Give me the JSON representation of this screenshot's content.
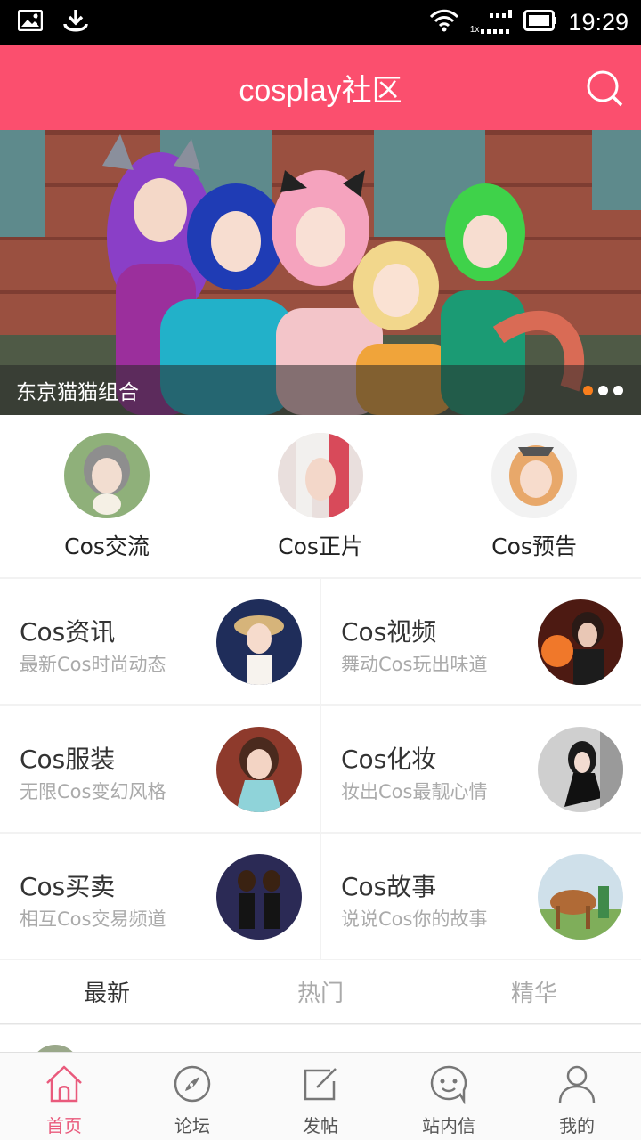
{
  "status_bar": {
    "network_label": "1x",
    "time": "19:29"
  },
  "header": {
    "title": "cosplay社区"
  },
  "banner": {
    "caption": "东京猫猫组合",
    "dots": [
      true,
      false,
      false
    ]
  },
  "quick_categories": [
    {
      "label": "Cos交流"
    },
    {
      "label": "Cos正片"
    },
    {
      "label": "Cos预告"
    }
  ],
  "categories": [
    {
      "title": "Cos资讯",
      "subtitle": "最新Cos时尚动态"
    },
    {
      "title": "Cos视频",
      "subtitle": "舞动Cos玩出味道"
    },
    {
      "title": "Cos服装",
      "subtitle": "无限Cos变幻风格"
    },
    {
      "title": "Cos化妆",
      "subtitle": "妆出Cos最靓心情"
    },
    {
      "title": "Cos买卖",
      "subtitle": "相互Cos交易频道"
    },
    {
      "title": "Cos故事",
      "subtitle": "说说Cos你的故事"
    }
  ],
  "tabs": [
    {
      "label": "最新",
      "active": true
    },
    {
      "label": "热门",
      "active": false
    },
    {
      "label": "精华",
      "active": false
    }
  ],
  "bottom_nav": [
    {
      "label": "首页",
      "icon": "home-icon",
      "active": true
    },
    {
      "label": "论坛",
      "icon": "compass-icon",
      "active": false
    },
    {
      "label": "发帖",
      "icon": "edit-icon",
      "active": false
    },
    {
      "label": "站内信",
      "icon": "message-icon",
      "active": false
    },
    {
      "label": "我的",
      "icon": "user-icon",
      "active": false
    }
  ],
  "colors": {
    "brand": "#fb4f6e",
    "active_nav": "#e95a7c",
    "active_dot": "#f97e1c"
  }
}
